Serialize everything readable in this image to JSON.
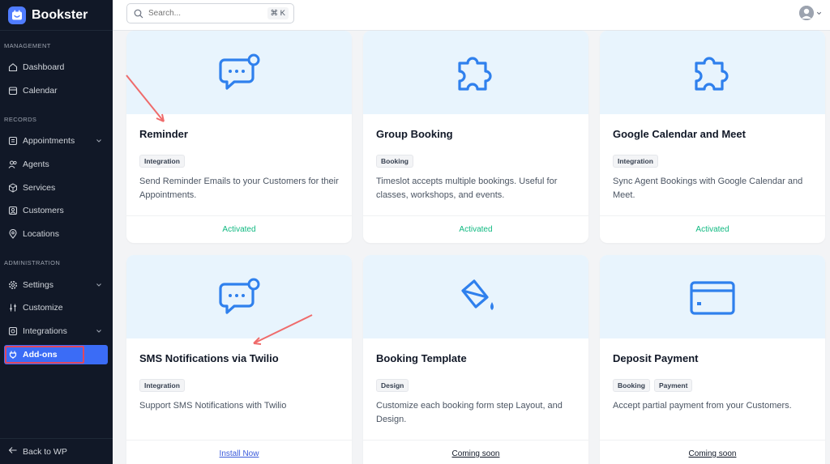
{
  "brand": {
    "name": "Bookster"
  },
  "sidebar": {
    "sections": [
      "MANAGEMENT",
      "RECORDS",
      "ADMINISTRATION"
    ],
    "items": [
      {
        "label": "Dashboard",
        "icon": "home-icon"
      },
      {
        "label": "Calendar",
        "icon": "calendar-icon"
      },
      {
        "label": "Appointments",
        "icon": "appointments-icon"
      },
      {
        "label": "Agents",
        "icon": "agents-icon"
      },
      {
        "label": "Services",
        "icon": "box-icon"
      },
      {
        "label": "Customers",
        "icon": "customer-icon"
      },
      {
        "label": "Locations",
        "icon": "location-icon"
      },
      {
        "label": "Settings",
        "icon": "gear-icon"
      },
      {
        "label": "Customize",
        "icon": "sliders-icon"
      },
      {
        "label": "Integrations",
        "icon": "integrations-icon"
      },
      {
        "label": "Add-ons",
        "icon": "plug-icon"
      }
    ],
    "back_label": "Back to WP",
    "active_color": "#3b6cf6"
  },
  "search": {
    "placeholder": "Search...",
    "shortcut": "⌘ K"
  },
  "addons": [
    {
      "title": "Reminder",
      "tags": [
        "Integration"
      ],
      "description": "Send Reminder Emails to your Customers for their Appointments.",
      "status": "Activated"
    },
    {
      "title": "Group Booking",
      "tags": [
        "Booking"
      ],
      "description": "Timeslot accepts multiple bookings. Useful for classes, workshops, and events.",
      "status": "Activated"
    },
    {
      "title": "Google Calendar and Meet",
      "tags": [
        "Integration"
      ],
      "description": "Sync Agent Bookings with Google Calendar and Meet.",
      "status": "Activated"
    },
    {
      "title": "SMS Notifications via Twilio",
      "tags": [
        "Integration"
      ],
      "description": "Support SMS Notifications with Twilio",
      "status": "Install Now"
    },
    {
      "title": "Booking Template",
      "tags": [
        "Design"
      ],
      "description": "Customize each booking form step Layout, and Design.",
      "status": "Coming soon"
    },
    {
      "title": "Deposit Payment",
      "tags": [
        "Booking",
        "Payment"
      ],
      "description": "Accept partial payment from your Customers.",
      "status": "Coming soon"
    }
  ],
  "colors": {
    "icon_blue": "#2f80ed",
    "activated": "#10b981",
    "card_top": "#e8f4fd"
  }
}
